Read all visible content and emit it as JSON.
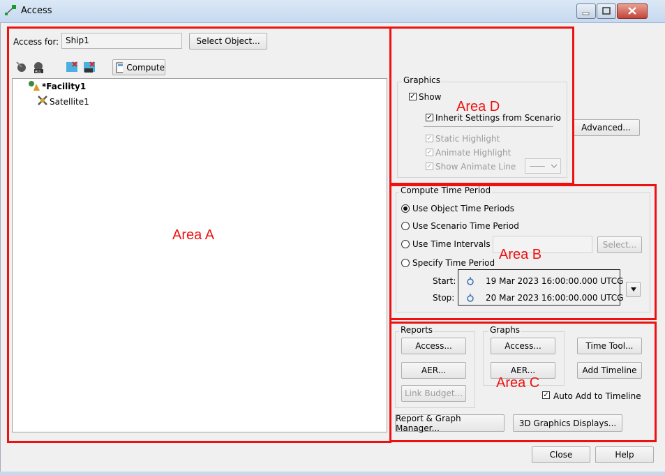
{
  "window": {
    "title": "Access"
  },
  "access_for": {
    "label": "Access for:",
    "value": "Ship1",
    "select_object": "Select Object..."
  },
  "toolbar": {
    "compute": "Compute"
  },
  "tree": {
    "items": [
      "*Facility1",
      "Satellite1"
    ]
  },
  "graphics": {
    "title": "Graphics",
    "show": "Show",
    "inherit": "Inherit Settings from Scenario",
    "static_highlight": "Static Highlight",
    "animate_highlight": "Animate Highlight",
    "show_animate_line": "Show Animate Line",
    "advanced": "Advanced..."
  },
  "time_period": {
    "title": "Compute Time Period",
    "opt_object": "Use Object Time Periods",
    "opt_scenario": "Use Scenario Time Period",
    "opt_intervals": "Use Time Intervals",
    "opt_specify": "Specify Time Period",
    "select": "Select...",
    "start_label": "Start:",
    "start_value": "19 Mar 2023 16:00:00.000 UTCG",
    "stop_label": "Stop:",
    "stop_value": "20 Mar 2023 16:00:00.000 UTCG"
  },
  "reports": {
    "title": "Reports",
    "access": "Access...",
    "aer": "AER...",
    "link_budget": "Link Budget..."
  },
  "graphs": {
    "title": "Graphs",
    "access": "Access...",
    "aer": "AER..."
  },
  "timeline": {
    "time_tool": "Time Tool...",
    "add_timeline": "Add Timeline",
    "auto_add": "Auto Add to Timeline"
  },
  "managers": {
    "report_graph": "Report & Graph Manager...",
    "graphics_3d": "3D Graphics Displays..."
  },
  "footer": {
    "close": "Close",
    "help": "Help"
  },
  "annotations": {
    "area_a": "Area A",
    "area_b": "Area B",
    "area_c": "Area C",
    "area_d": "Area D"
  },
  "colors": {
    "annotation_red": "#ee1111",
    "title_bar": "#c6d9ef",
    "window_bg": "#f0f0f0"
  }
}
